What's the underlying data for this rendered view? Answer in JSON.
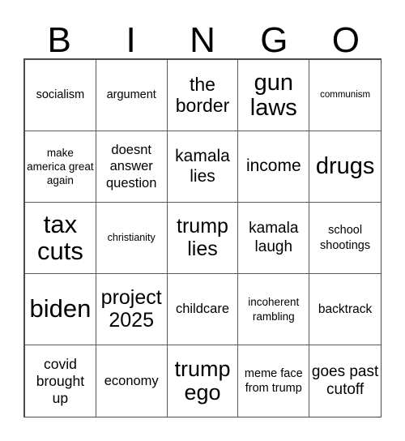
{
  "card": {
    "title": "BINGO",
    "header_letters": [
      "B",
      "I",
      "N",
      "G",
      "O"
    ],
    "colors": {
      "background": "#ffffff",
      "text": "#000000",
      "grid_line": "#5a5a5a",
      "grid_outer": "#4a4a4a"
    },
    "grid": {
      "columns": 5,
      "rows": 5,
      "cells": [
        {
          "text": "socialism",
          "size": "fs-14"
        },
        {
          "text": "argument",
          "size": "fs-14"
        },
        {
          "text": "the border",
          "size": "fs-23"
        },
        {
          "text": "gun laws",
          "size": "fs-29"
        },
        {
          "text": "communism",
          "size": "fs-11"
        },
        {
          "text": "make america great again",
          "size": "fs-13"
        },
        {
          "text": "doesnt answer question",
          "size": "fs-16"
        },
        {
          "text": "kamala lies",
          "size": "fs-21"
        },
        {
          "text": "income",
          "size": "fs-21"
        },
        {
          "text": "drugs",
          "size": "fs-29"
        },
        {
          "text": "tax cuts",
          "size": "fs-31"
        },
        {
          "text": "christianity",
          "size": "fs-12"
        },
        {
          "text": "trump lies",
          "size": "fs-25"
        },
        {
          "text": "kamala laugh",
          "size": "fs-19"
        },
        {
          "text": "school shootings",
          "size": "fs-14"
        },
        {
          "text": "biden",
          "size": "fs-31"
        },
        {
          "text": "project 2025",
          "size": "fs-25"
        },
        {
          "text": "childcare",
          "size": "fs-16"
        },
        {
          "text": "incoherent rambling",
          "size": "fs-13"
        },
        {
          "text": "backtrack",
          "size": "fs-15"
        },
        {
          "text": "covid brought up",
          "size": "fs-17"
        },
        {
          "text": "economy",
          "size": "fs-16"
        },
        {
          "text": "trump ego",
          "size": "fs-27"
        },
        {
          "text": "meme face from trump",
          "size": "fs-14"
        },
        {
          "text": "goes past cutoff",
          "size": "fs-19"
        }
      ]
    }
  }
}
